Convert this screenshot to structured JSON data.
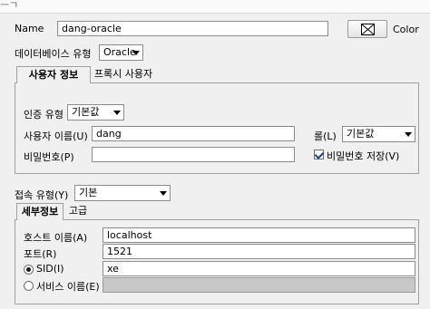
{
  "window": {
    "top_glyph": "ㅡㄱ"
  },
  "connection": {
    "name_label": "Name",
    "name_value": "dang-oracle",
    "color_label": "Color",
    "dbtype_label": "데이터베이스 유형",
    "dbtype_value": "Oracle"
  },
  "user_tabs": [
    {
      "label": "사용자 정보",
      "active": true
    },
    {
      "label": "프록시 사용자",
      "active": false
    }
  ],
  "user_info": {
    "auth_type_label": "인증 유형",
    "auth_type_value": "기본값",
    "username_label": "사용자 이름(U)",
    "username_value": "dang",
    "role_label": "롤(L)",
    "role_value": "기본값",
    "password_label": "비밀번호(P)",
    "password_value": "",
    "save_password_label": "비밀번호 저장(V)",
    "save_password_checked": true
  },
  "connection_type": {
    "label": "접속 유형(Y)",
    "value": "기본"
  },
  "detail_tabs": [
    {
      "label": "세부정보",
      "active": true
    },
    {
      "label": "고급",
      "active": false
    }
  ],
  "details": {
    "hostname_label": "호스트 이름(A)",
    "hostname_value": "localhost",
    "port_label": "포트(R)",
    "port_value": "1521",
    "sid_label": "SID(I)",
    "sid_value": "xe",
    "sid_selected": true,
    "service_label": "서비스 이름(E)",
    "service_value": "",
    "service_selected": false
  }
}
